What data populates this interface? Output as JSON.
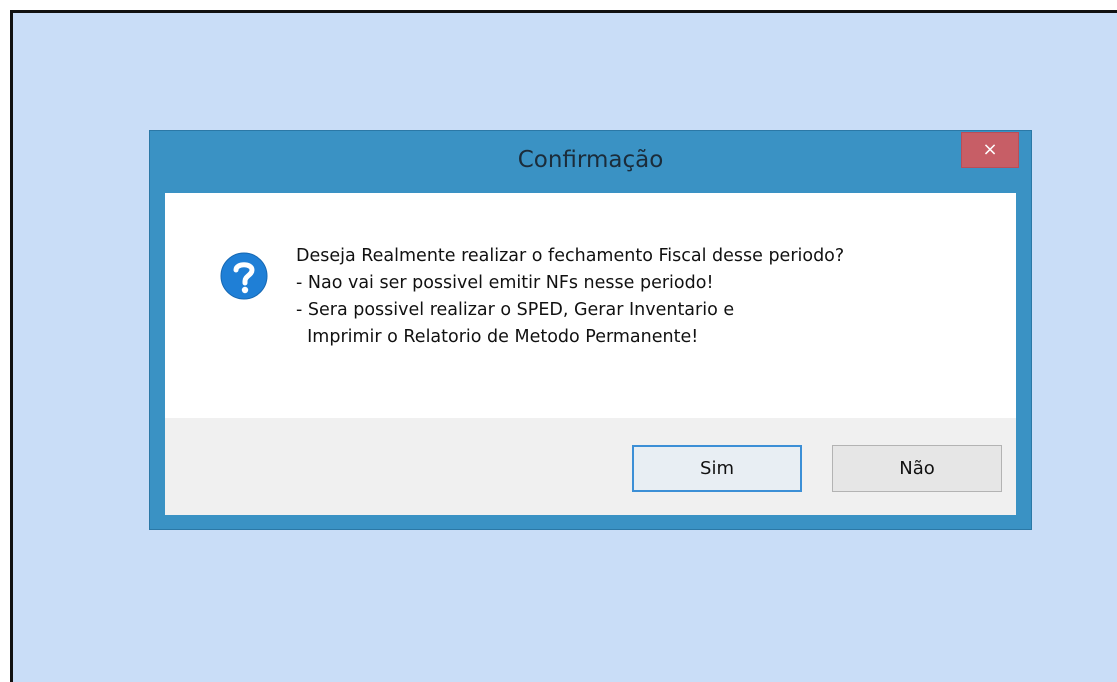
{
  "dialog": {
    "title": "Confirmação",
    "close_label": "×",
    "icon": "question-icon",
    "message_lines": [
      "Deseja Realmente realizar o fechamento Fiscal desse periodo?",
      "- Nao vai ser possivel emitir NFs nesse periodo!",
      "- Sera possivel realizar o SPED, Gerar Inventario e",
      "  Imprimir o Relatorio de Metodo Permanente!"
    ],
    "buttons": {
      "yes_label": "Sim",
      "no_label": "Não"
    }
  },
  "colors": {
    "desktop_background": "#c9ddf7",
    "window_frame": "#3a92c4",
    "close_button": "#c75e66",
    "icon_blue": "#1f7fd6",
    "focus_border": "#3c8fd6"
  }
}
